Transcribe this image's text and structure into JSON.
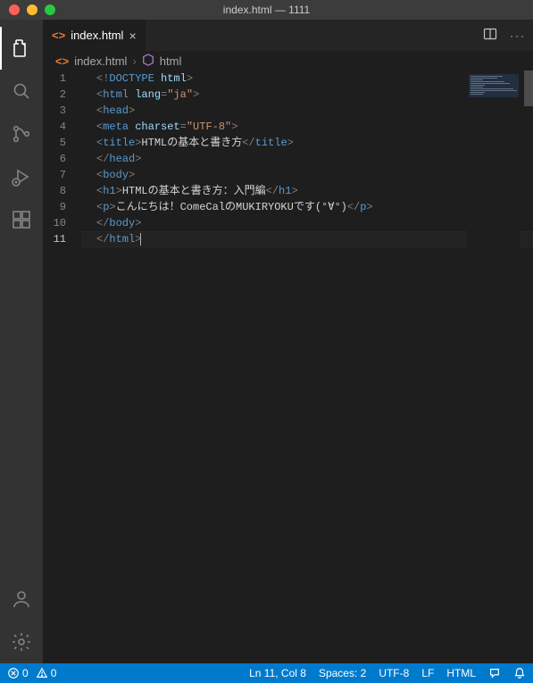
{
  "window": {
    "title": "index.html — 1111"
  },
  "tabs": [
    {
      "label": "index.html",
      "icon": "html-file-icon"
    }
  ],
  "breadcrumbs": {
    "file": "index.html",
    "symbol": "html"
  },
  "activitybar": {
    "items": [
      {
        "name": "explorer-icon",
        "active": true
      },
      {
        "name": "search-icon",
        "active": false
      },
      {
        "name": "scm-icon",
        "active": false
      },
      {
        "name": "debug-icon",
        "active": false
      },
      {
        "name": "extensions-icon",
        "active": false
      }
    ],
    "bottom": [
      {
        "name": "accounts-icon"
      },
      {
        "name": "settings-gear-icon"
      }
    ]
  },
  "editor": {
    "lines": [
      {
        "n": 1,
        "tokens": [
          [
            "punc",
            "<!"
          ],
          [
            "doctype-kw",
            "DOCTYPE"
          ],
          [
            "txt",
            " "
          ],
          [
            "attr",
            "html"
          ],
          [
            "punc",
            ">"
          ]
        ]
      },
      {
        "n": 2,
        "tokens": [
          [
            "punc",
            "<"
          ],
          [
            "tagn",
            "html"
          ],
          [
            "txt",
            " "
          ],
          [
            "attr",
            "lang"
          ],
          [
            "punc",
            "="
          ],
          [
            "str",
            "\"ja\""
          ],
          [
            "punc",
            ">"
          ]
        ]
      },
      {
        "n": 3,
        "tokens": [
          [
            "punc",
            "<"
          ],
          [
            "tagn",
            "head"
          ],
          [
            "punc",
            ">"
          ]
        ]
      },
      {
        "n": 4,
        "tokens": [
          [
            "punc",
            "<"
          ],
          [
            "tagn",
            "meta"
          ],
          [
            "txt",
            " "
          ],
          [
            "attr",
            "charset"
          ],
          [
            "punc",
            "="
          ],
          [
            "str",
            "\"UTF-8\""
          ],
          [
            "punc",
            ">"
          ]
        ]
      },
      {
        "n": 5,
        "tokens": [
          [
            "punc",
            "<"
          ],
          [
            "tagn",
            "title"
          ],
          [
            "punc",
            ">"
          ],
          [
            "txt",
            "HTMLの基本と書き方"
          ],
          [
            "punc",
            "</"
          ],
          [
            "tagn",
            "title"
          ],
          [
            "punc",
            ">"
          ]
        ]
      },
      {
        "n": 6,
        "tokens": [
          [
            "punc",
            "</"
          ],
          [
            "tagn",
            "head"
          ],
          [
            "punc",
            ">"
          ]
        ]
      },
      {
        "n": 7,
        "tokens": [
          [
            "punc",
            "<"
          ],
          [
            "tagn",
            "body"
          ],
          [
            "punc",
            ">"
          ]
        ]
      },
      {
        "n": 8,
        "tokens": [
          [
            "punc",
            "<"
          ],
          [
            "tagn",
            "h1"
          ],
          [
            "punc",
            ">"
          ],
          [
            "txt",
            "HTMLの基本と書き方：入門編"
          ],
          [
            "punc",
            "</"
          ],
          [
            "tagn",
            "h1"
          ],
          [
            "punc",
            ">"
          ]
        ]
      },
      {
        "n": 9,
        "tokens": [
          [
            "punc",
            "<"
          ],
          [
            "tagn",
            "p"
          ],
          [
            "punc",
            ">"
          ],
          [
            "txt",
            "こんにちは！ComeCalのMUKIRYOKUです(°∀°)"
          ],
          [
            "punc",
            "</"
          ],
          [
            "tagn",
            "p"
          ],
          [
            "punc",
            ">"
          ]
        ]
      },
      {
        "n": 10,
        "tokens": [
          [
            "punc",
            "</"
          ],
          [
            "tagn",
            "body"
          ],
          [
            "punc",
            ">"
          ]
        ]
      },
      {
        "n": 11,
        "tokens": [
          [
            "punc",
            "</"
          ],
          [
            "tagn",
            "html"
          ],
          [
            "punc",
            ">"
          ]
        ],
        "current": true
      }
    ]
  },
  "statusbar": {
    "errors": "0",
    "warnings": "0",
    "lncol": "Ln 11, Col 8",
    "spaces": "Spaces: 2",
    "encoding": "UTF-8",
    "eol": "LF",
    "language": "HTML"
  }
}
